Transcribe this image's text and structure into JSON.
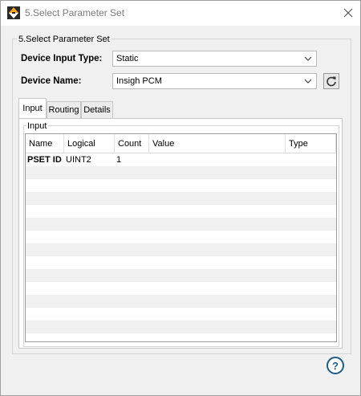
{
  "window": {
    "title": "5.Select Parameter Set",
    "accent_color": "#f5a623"
  },
  "group": {
    "title": "5.Select Parameter Set"
  },
  "form": {
    "device_input_type_label": "Device Input Type:",
    "device_input_type_value": "Static",
    "device_name_label": "Device Name:",
    "device_name_value": "Insigh PCM"
  },
  "tabs": [
    {
      "label": "Input",
      "active": true
    },
    {
      "label": "Routing",
      "active": false
    },
    {
      "label": "Details",
      "active": false
    }
  ],
  "input_panel": {
    "title": "Input",
    "columns": [
      "Name",
      "Logical",
      "Count",
      "Value",
      "Type"
    ],
    "rows": [
      {
        "name": "PSET ID",
        "logical": "UINT2",
        "count": "1",
        "value": "",
        "type": ""
      }
    ]
  },
  "icons": {
    "app": "app-logo-icon",
    "close": "close-icon",
    "dropdown": "chevron-down-icon",
    "refresh": "refresh-icon",
    "help": "help-icon"
  },
  "help": {
    "glyph": "?"
  }
}
